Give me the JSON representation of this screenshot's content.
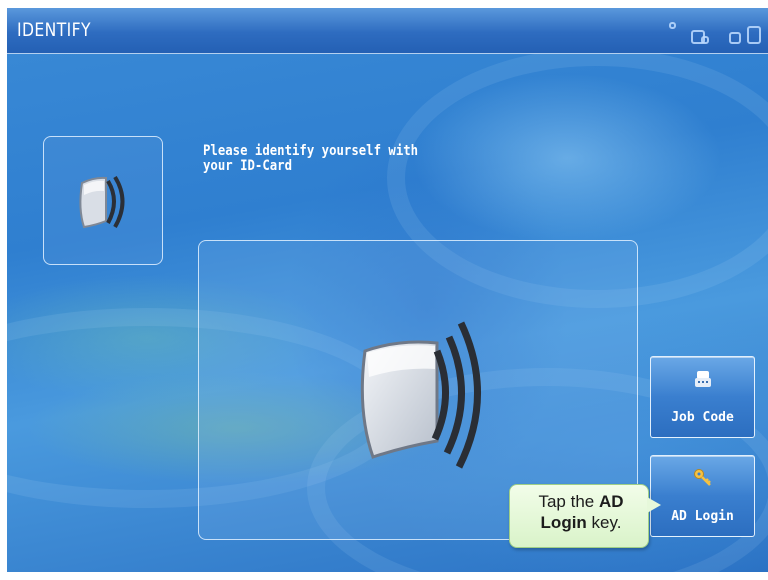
{
  "header": {
    "title": "IDENTIFY"
  },
  "main": {
    "instruction_line1": "Please identify yourself with",
    "instruction_line2": "your ID-Card"
  },
  "side_buttons": {
    "job_code": {
      "label": "Job Code",
      "icon": "keypad-icon"
    },
    "ad_login": {
      "label": "AD Login",
      "icon": "key-icon"
    }
  },
  "callout": {
    "prefix": "Tap the ",
    "bold1": "AD",
    "bold2": "Login",
    "suffix": " key."
  },
  "colors": {
    "title_bar": "#2e6cc0",
    "background": "#3a8ad6",
    "callout_fill": "#d9f3c9",
    "key_icon": "#f5c242"
  }
}
